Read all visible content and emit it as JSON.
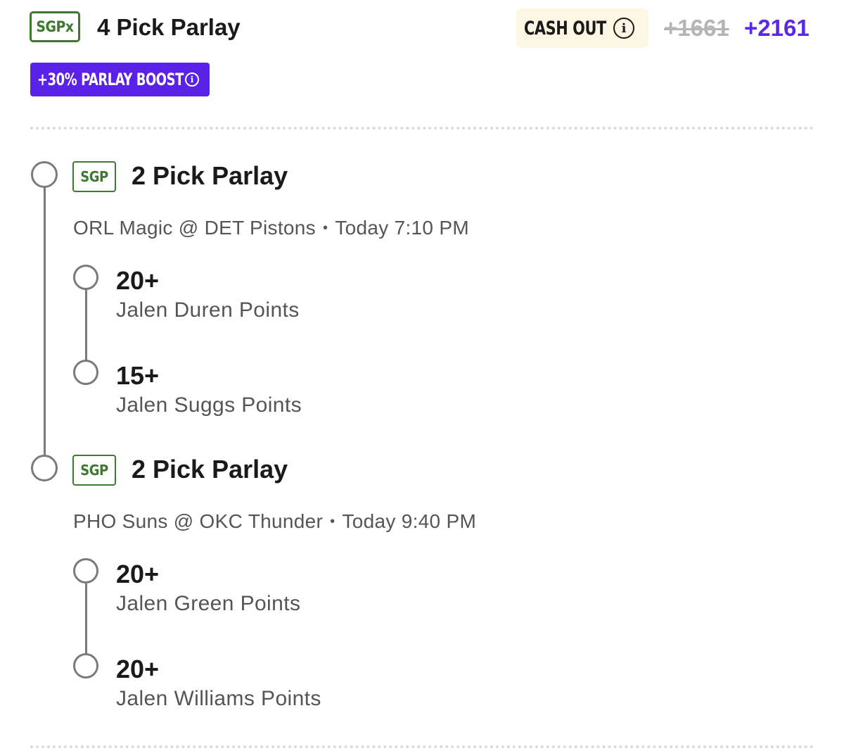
{
  "header": {
    "badge": "SGPx",
    "title": "4 Pick Parlay",
    "cashout_label": "CASH OUT",
    "cashout_info_icon": "info-icon",
    "old_odds": "+1661",
    "new_odds": "+2161",
    "boost_label": "+30% PARLAY BOOST",
    "boost_info_icon": "info-icon"
  },
  "colors": {
    "badge_green": "#3d7a2f",
    "boost_purple": "#5a21e6",
    "odds_purple": "#5a28e6",
    "cashout_bg": "#fcf7e3",
    "old_odds_gray": "#b5b5b5",
    "timeline_gray": "#7a7a7a"
  },
  "legs": [
    {
      "badge": "SGP",
      "title": "2 Pick Parlay",
      "matchup": "ORL Magic @ DET Pistons",
      "separator": "•",
      "time": "Today 7:10 PM",
      "picks": [
        {
          "value": "20+",
          "description": "Jalen Duren Points"
        },
        {
          "value": "15+",
          "description": "Jalen Suggs Points"
        }
      ]
    },
    {
      "badge": "SGP",
      "title": "2 Pick Parlay",
      "matchup": "PHO Suns @ OKC Thunder",
      "separator": "•",
      "time": "Today 9:40 PM",
      "picks": [
        {
          "value": "20+",
          "description": "Jalen Green Points"
        },
        {
          "value": "20+",
          "description": "Jalen Williams Points"
        }
      ]
    }
  ]
}
